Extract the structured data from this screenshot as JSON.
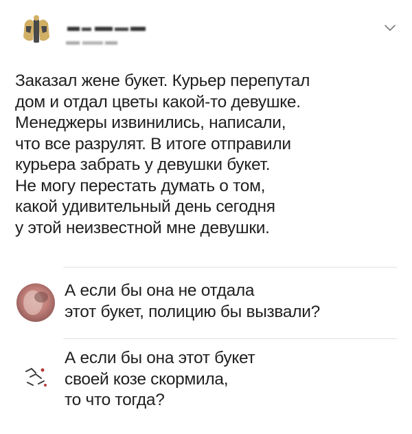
{
  "post": {
    "lines": [
      "Заказал жене букет. Курьер перепутал",
      "дом и отдал цветы какой-то девушке.",
      "Менеджеры извинились, написали,",
      "что все разрулят. В итоге отправили",
      "курьера забрать у девушки букет.",
      "Не могу перестать думать о том,",
      "какой удивительный день сегодня",
      "у этой неизвестной мне девушки."
    ]
  },
  "comments": [
    {
      "lines": [
        "А если бы она не отдала",
        "этот букет, полицию бы вызвали?"
      ]
    },
    {
      "lines": [
        "А если бы она этот букет",
        "своей козе скормила,",
        "то что тогда?"
      ]
    }
  ],
  "icons": {
    "menu": "chevron-down-icon"
  },
  "colors": {
    "text": "#1f1f1f",
    "divider": "#e1e1e1",
    "chevron": "#7a7a7a"
  }
}
